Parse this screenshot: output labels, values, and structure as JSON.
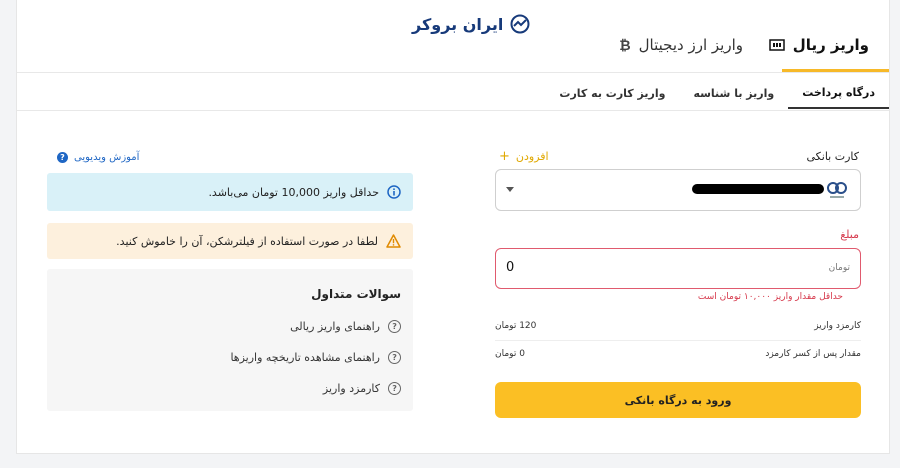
{
  "brand": {
    "name": "ایران بروکر"
  },
  "top_tabs": [
    {
      "label": "واریز ریال",
      "icon": "banknote-icon",
      "active": true
    },
    {
      "label": "واریز ارز دیجیتال",
      "icon": "bitcoin-icon",
      "active": false
    }
  ],
  "sub_tabs": [
    {
      "label": "درگاه پرداخت",
      "active": true
    },
    {
      "label": "واریز با شناسه",
      "active": false
    },
    {
      "label": "واریز کارت به کارت",
      "active": false
    }
  ],
  "form": {
    "bank_card_label": "کارت بانکی",
    "add_label": "افزودن",
    "add_icon": "+",
    "amount_label": "مبلغ",
    "amount_value": "0",
    "amount_unit": "تومان",
    "error": "حداقل مقدار واریز ۱۰,۰۰۰ تومان است",
    "fee_label": "کارمزد واریز",
    "fee_value": "120 تومان",
    "net_label": "مقدار پس از کسر کارمزد",
    "net_value": "0 تومان",
    "submit_label": "ورود به درگاه بانکی"
  },
  "side": {
    "video_label": "آموزش ویدیویی",
    "info_text": "حداقل واریز 10,000 تومان می‌باشد.",
    "warn_text": "لطفا در صورت استفاده از فیلترشکن، آن را خاموش کنید.",
    "faq_title": "سوالات متداول",
    "faq_items": [
      "راهنمای واریز ریالی",
      "راهنمای مشاهده تاریخچه واریزها",
      "کارمزد واریز"
    ]
  },
  "colors": {
    "accent": "#fbbf24",
    "error": "#d6384b",
    "link": "#1e66c4",
    "brand": "#173a7a"
  }
}
